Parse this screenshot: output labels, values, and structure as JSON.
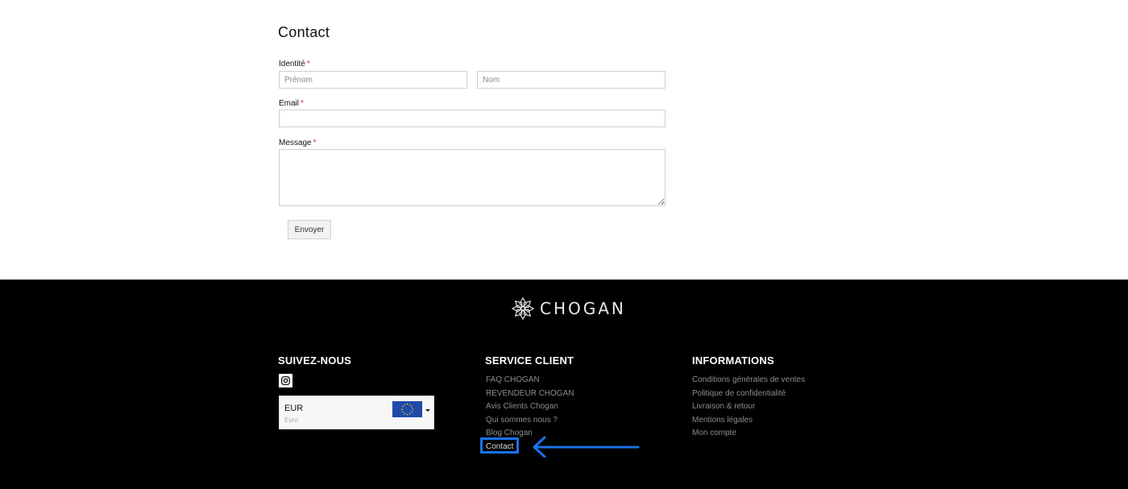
{
  "form": {
    "title": "Contact",
    "identity_label": "Identité",
    "email_label": "Email",
    "message_label": "Message",
    "required_mark": "*",
    "first_name_placeholder": "Prénom",
    "last_name_placeholder": "Nom",
    "email_value": "",
    "message_value": "",
    "submit_label": "Envoyer"
  },
  "footer": {
    "logo_text": "CHOGAN",
    "follow": {
      "title": "SUIVEZ-NOUS",
      "social_icon": "instagram-icon"
    },
    "currency": {
      "code": "EUR",
      "name": "Euro",
      "flag_icon": "eu-flag-icon"
    },
    "service": {
      "title": "SERVICE CLIENT",
      "links": [
        "FAQ CHOGAN",
        "REVENDEUR CHOGAN",
        "Avis Clients Chogan",
        "Qui sommes nous ?",
        "Blog Chogan",
        "Contact"
      ]
    },
    "info": {
      "title": "INFORMATIONS",
      "links": [
        "Conditions générales de ventes",
        "Politique de confidentialité",
        "Livraison & retour",
        "Mentions légales",
        "Mon compte"
      ]
    }
  },
  "annotation": {
    "color": "#1a73e8"
  },
  "colors": {
    "footer_bg": "#000000",
    "required": "#dd2222",
    "link": "#8d8d8d"
  }
}
